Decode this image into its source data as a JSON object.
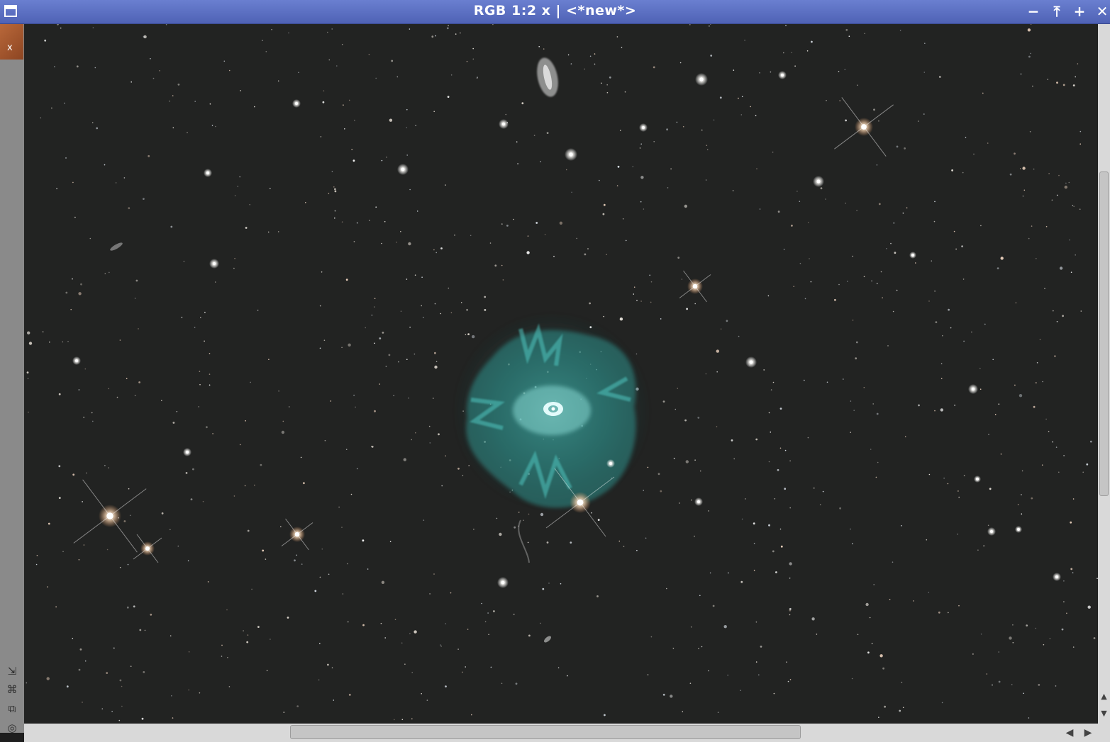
{
  "window": {
    "title": "RGB 1:2 x | <*new*>",
    "buttons": [
      "minimize",
      "shade",
      "maximize",
      "close"
    ]
  },
  "sidebar": {
    "close_tab_label": "x",
    "tools": [
      "fit-view-icon",
      "zoom-view-icon",
      "clone-view-icon",
      "preview-mode-icon"
    ]
  },
  "image": {
    "subject": "",
    "colors": {
      "background": "#222322",
      "nebula": "#3fa3a0",
      "title_bar": "#5a6ec0"
    }
  }
}
